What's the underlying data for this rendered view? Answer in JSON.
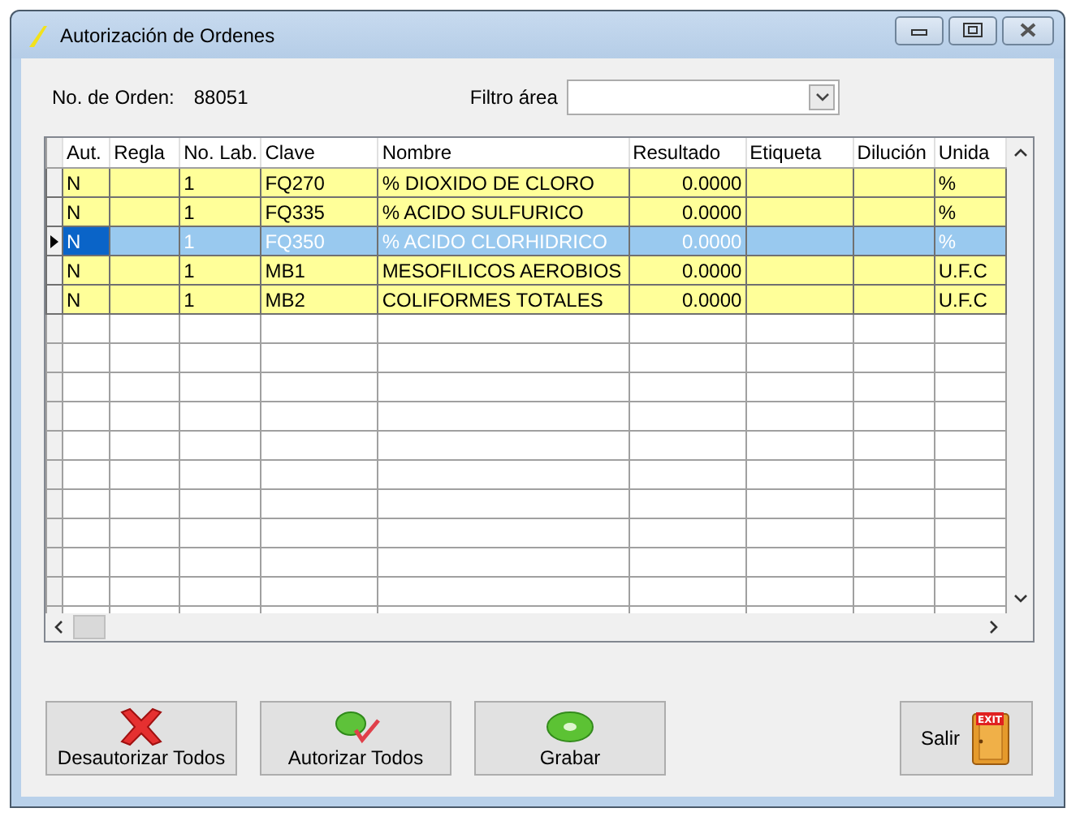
{
  "window": {
    "title": "Autorización de Ordenes"
  },
  "order": {
    "label": "No. de Orden:",
    "value": "88051"
  },
  "filter": {
    "label": "Filtro área"
  },
  "table": {
    "columns": [
      "Aut.",
      "Regla",
      "No. Lab.",
      "Clave",
      "Nombre",
      "Resultado",
      "Etiqueta",
      "Dilución",
      "Unida"
    ],
    "rows": [
      {
        "aut": "N",
        "no_lab": "1",
        "clave": "FQ270",
        "nombre": "% DIOXIDO DE CLORO",
        "resultado": "0.0000",
        "unidad": "%",
        "selected": false
      },
      {
        "aut": "N",
        "no_lab": "1",
        "clave": "FQ335",
        "nombre": "% ACIDO SULFURICO",
        "resultado": "0.0000",
        "unidad": "%",
        "selected": false
      },
      {
        "aut": "N",
        "no_lab": "1",
        "clave": "FQ350",
        "nombre": "% ACIDO CLORHIDRICO",
        "resultado": "0.0000",
        "unidad": "%",
        "selected": true
      },
      {
        "aut": "N",
        "no_lab": "1",
        "clave": "MB1",
        "nombre": "MESOFILICOS AEROBIOS",
        "resultado": "0.0000",
        "unidad": "U.F.C",
        "selected": false
      },
      {
        "aut": "N",
        "no_lab": "1",
        "clave": "MB2",
        "nombre": "COLIFORMES TOTALES",
        "resultado": "0.0000",
        "unidad": "U.F.C",
        "selected": false
      }
    ]
  },
  "buttons": [
    {
      "label": "Desautorizar Todos",
      "kind": "cross"
    },
    {
      "label": "Autorizar Todos",
      "kind": "approve"
    },
    {
      "label": "Grabar",
      "kind": "disc"
    }
  ],
  "exit": {
    "label": "Salir",
    "sign": "EXIT"
  }
}
